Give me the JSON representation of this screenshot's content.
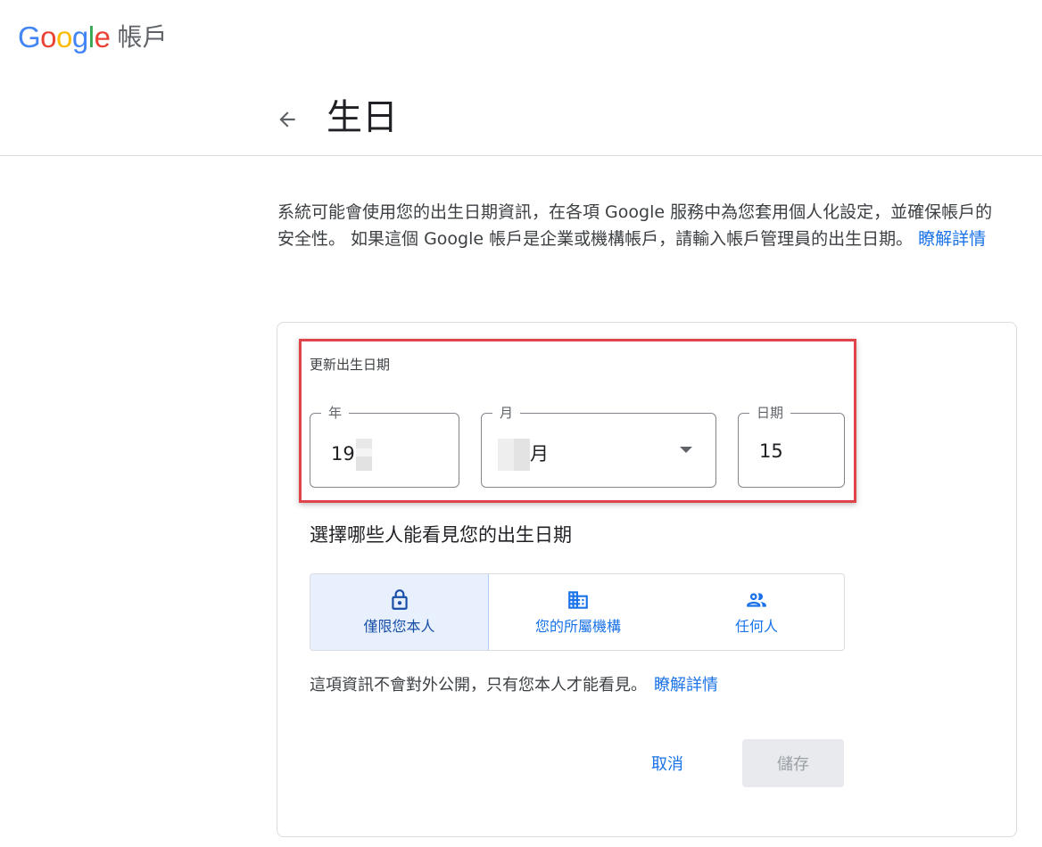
{
  "header": {
    "logo_letters": [
      {
        "char": "G",
        "color": "#4285F4"
      },
      {
        "char": "o",
        "color": "#EA4335"
      },
      {
        "char": "o",
        "color": "#FBBC05"
      },
      {
        "char": "g",
        "color": "#4285F4"
      },
      {
        "char": "l",
        "color": "#34A853"
      },
      {
        "char": "e",
        "color": "#EA4335"
      }
    ],
    "product_name": "帳戶"
  },
  "page": {
    "back_icon": "arrow-left-icon",
    "title": "生日"
  },
  "intro": {
    "text": "系統可能會使用您的出生日期資訊，在各項 Google 服務中為您套用個人化設定，並確保帳戶的安全性。 如果這個 Google 帳戶是企業或機構帳戶，請輸入帳戶管理員的出生日期。",
    "learn_more": "瞭解詳情"
  },
  "birthday_form": {
    "section_label": "更新出生日期",
    "year": {
      "label": "年",
      "value_visible": "19"
    },
    "month": {
      "label": "月",
      "value_suffix": "月"
    },
    "day": {
      "label": "日期",
      "value": "15"
    }
  },
  "visibility": {
    "heading": "選擇哪些人能看見您的出生日期",
    "options": [
      {
        "label": "僅限您本人",
        "icon": "lock-icon",
        "selected": true
      },
      {
        "label": "您的所屬機構",
        "icon": "building-icon",
        "selected": false
      },
      {
        "label": "任何人",
        "icon": "people-icon",
        "selected": false
      }
    ],
    "note": "這項資訊不會對外公開，只有您本人才能看見。",
    "learn_more": "瞭解詳情"
  },
  "actions": {
    "cancel_label": "取消",
    "save_label": "儲存"
  },
  "colors": {
    "accent": "#1a73e8",
    "highlight_border": "#e0444b",
    "selected_bg": "#e8f0fe"
  }
}
